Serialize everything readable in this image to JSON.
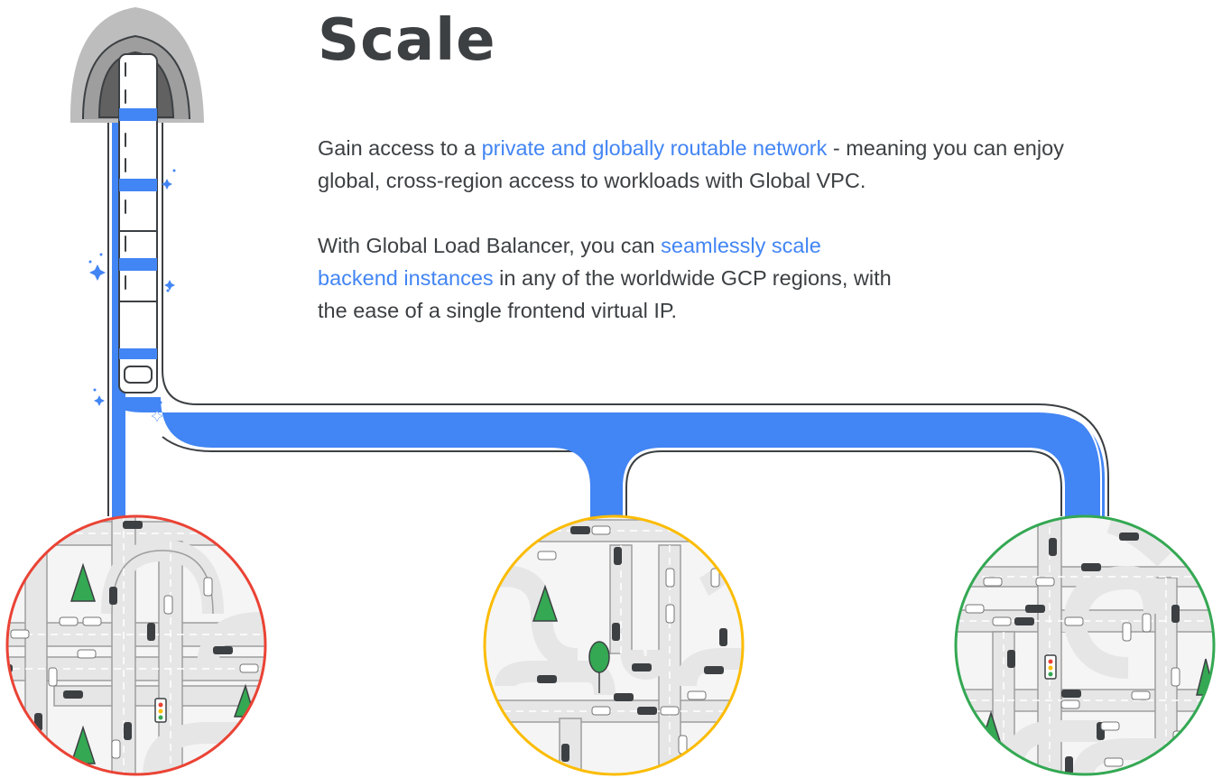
{
  "heading": "Scale",
  "paragraphs": [
    {
      "before": "Gain access to a ",
      "link": "private and globally routable network",
      "after": " - meaning you can enjoy global, cross-region access to workloads with Global VPC."
    },
    {
      "before": "With Global Load Balancer, you can ",
      "link": "seamlessly scale backend instances",
      "after": " in any of the worldwide GCP regions, with the ease of a single frontend virtual IP."
    }
  ],
  "colors": {
    "pipe": "#4285f4",
    "heading": "#3c4043",
    "link": "#4285f4",
    "region_left_border": "#ea4335",
    "region_middle_border": "#fbbc04",
    "region_right_border": "#34a853",
    "road": "#e6e6e6",
    "tree": "#34a853"
  },
  "illustration": {
    "regions": [
      "region-red",
      "region-yellow",
      "region-green"
    ],
    "icons": [
      "tunnel-icon",
      "train-icon",
      "sparkle-icon",
      "car-icon",
      "tree-icon",
      "traffic-light-icon"
    ]
  }
}
